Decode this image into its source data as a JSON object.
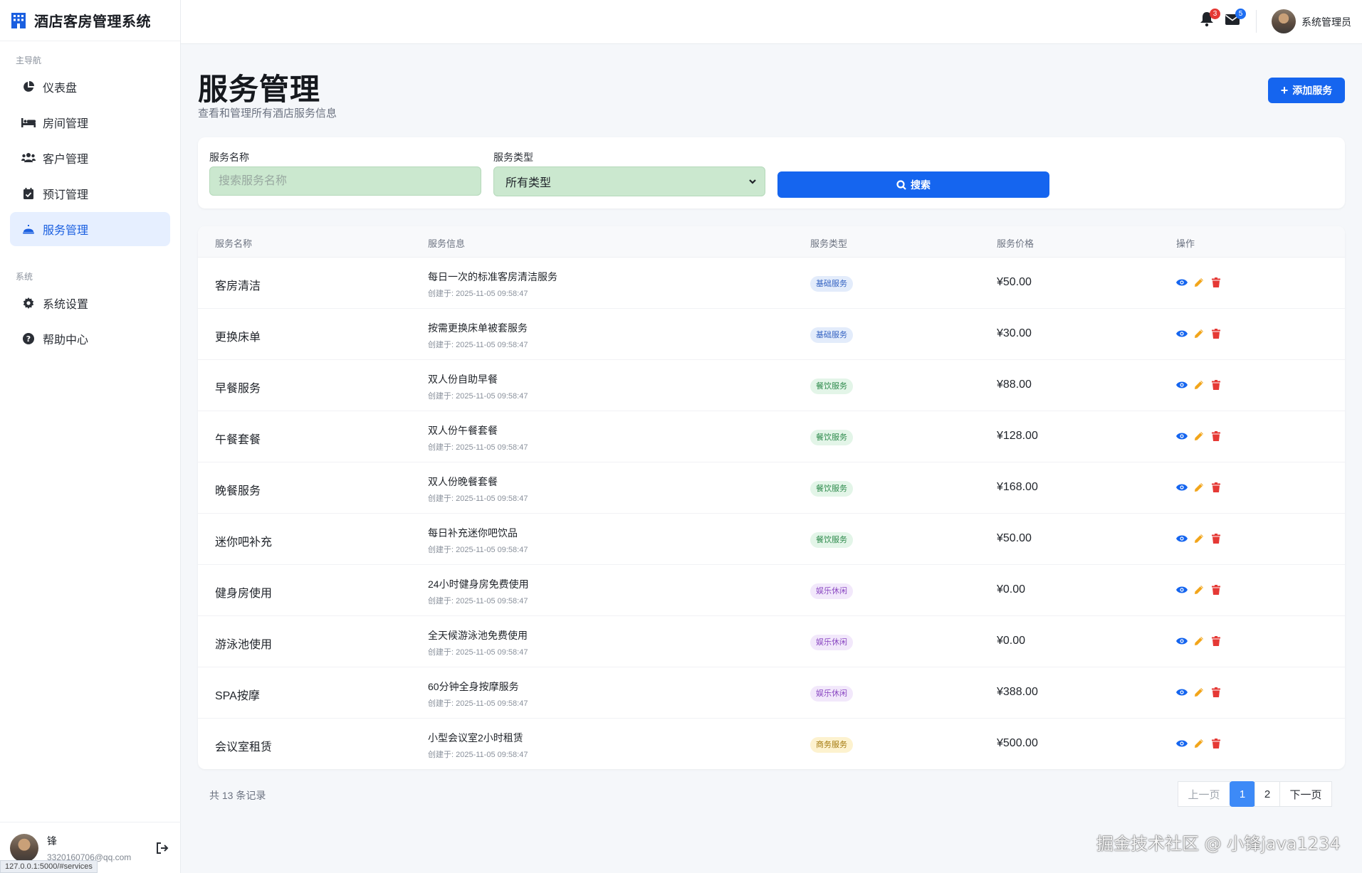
{
  "app": {
    "title": "酒店客房管理系统"
  },
  "sidebar": {
    "sections": [
      {
        "label": "主导航"
      },
      {
        "label": "系统"
      }
    ],
    "main_items": [
      {
        "label": "仪表盘",
        "icon": "pie-chart-icon"
      },
      {
        "label": "房间管理",
        "icon": "bed-icon"
      },
      {
        "label": "客户管理",
        "icon": "users-icon"
      },
      {
        "label": "预订管理",
        "icon": "calendar-icon"
      },
      {
        "label": "服务管理",
        "icon": "bell-service-icon",
        "active": true
      }
    ],
    "system_items": [
      {
        "label": "系统设置",
        "icon": "gear-icon"
      },
      {
        "label": "帮助中心",
        "icon": "question-icon"
      }
    ],
    "user": {
      "name": "锋",
      "email": "3320160706@qq.com"
    },
    "status_url": "127.0.0.1:5000/#services"
  },
  "topbar": {
    "notifications_count": "3",
    "messages_count": "5",
    "user_name": "系统管理员"
  },
  "header": {
    "title": "服务管理",
    "subtitle": "查看和管理所有酒店服务信息",
    "add_button": "添加服务"
  },
  "filter": {
    "name_label": "服务名称",
    "name_placeholder": "搜索服务名称",
    "type_label": "服务类型",
    "type_selected": "所有类型",
    "search_button": "搜索"
  },
  "table": {
    "headers": [
      "服务名称",
      "服务信息",
      "服务类型",
      "服务价格",
      "操作"
    ],
    "rows": [
      {
        "name": "客房清洁",
        "desc": "每日一次的标准客房清洁服务",
        "created": "创建于: 2025-11-05 09:58:47",
        "type": "基础服务",
        "price": "¥50.00"
      },
      {
        "name": "更换床单",
        "desc": "按需更换床单被套服务",
        "created": "创建于: 2025-11-05 09:58:47",
        "type": "基础服务",
        "price": "¥30.00"
      },
      {
        "name": "早餐服务",
        "desc": "双人份自助早餐",
        "created": "创建于: 2025-11-05 09:58:47",
        "type": "餐饮服务",
        "price": "¥88.00"
      },
      {
        "name": "午餐套餐",
        "desc": "双人份午餐套餐",
        "created": "创建于: 2025-11-05 09:58:47",
        "type": "餐饮服务",
        "price": "¥128.00"
      },
      {
        "name": "晚餐服务",
        "desc": "双人份晚餐套餐",
        "created": "创建于: 2025-11-05 09:58:47",
        "type": "餐饮服务",
        "price": "¥168.00"
      },
      {
        "name": "迷你吧补充",
        "desc": "每日补充迷你吧饮品",
        "created": "创建于: 2025-11-05 09:58:47",
        "type": "餐饮服务",
        "price": "¥50.00"
      },
      {
        "name": "健身房使用",
        "desc": "24小时健身房免费使用",
        "created": "创建于: 2025-11-05 09:58:47",
        "type": "娱乐休闲",
        "price": "¥0.00"
      },
      {
        "name": "游泳池使用",
        "desc": "全天候游泳池免费使用",
        "created": "创建于: 2025-11-05 09:58:47",
        "type": "娱乐休闲",
        "price": "¥0.00"
      },
      {
        "name": "SPA按摩",
        "desc": "60分钟全身按摩服务",
        "created": "创建于: 2025-11-05 09:58:47",
        "type": "娱乐休闲",
        "price": "¥388.00"
      },
      {
        "name": "会议室租赁",
        "desc": "小型会议室2小时租赁",
        "created": "创建于: 2025-11-05 09:58:47",
        "type": "商务服务",
        "price": "¥500.00"
      }
    ]
  },
  "pagination": {
    "total": "共 13 条记录",
    "prev": "上一页",
    "pages": [
      "1",
      "2"
    ],
    "current": "1",
    "next": "下一页"
  },
  "watermark": "掘金技术社区 @ 小锋java1234",
  "colors": {
    "primary": "#1565ef",
    "active_bg": "#e6efff",
    "input_bg": "#cbe8cf",
    "badge_red": "#e53935",
    "badge_blue": "#1e6ef2"
  }
}
